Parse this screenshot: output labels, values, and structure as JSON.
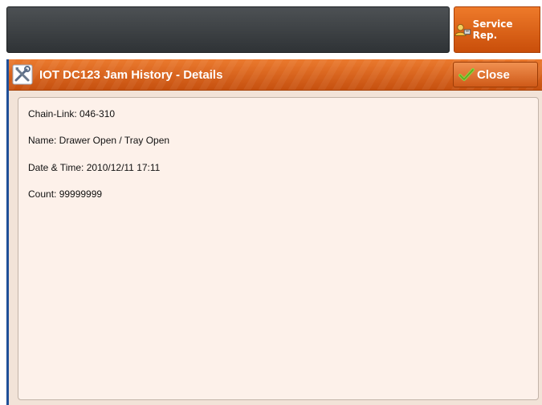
{
  "header": {
    "service_rep_label": "Service Rep."
  },
  "dialog": {
    "title": "IOT DC123 Jam History - Details",
    "close_label": "Close",
    "details": [
      "Chain-Link: 046-310",
      "Name: Drawer Open / Tray Open",
      "Date & Time: 2010/12/11 17:11",
      "Count: 99999999"
    ]
  },
  "icons": {
    "service": "service-rep-icon",
    "title": "tools-icon",
    "close": "checkmark-icon"
  },
  "colors": {
    "accent_orange": "#e36f24",
    "dark_bar": "#3b3f42",
    "panel_bg": "#fdf1ea",
    "dialog_border_blue": "#1f4f98"
  }
}
